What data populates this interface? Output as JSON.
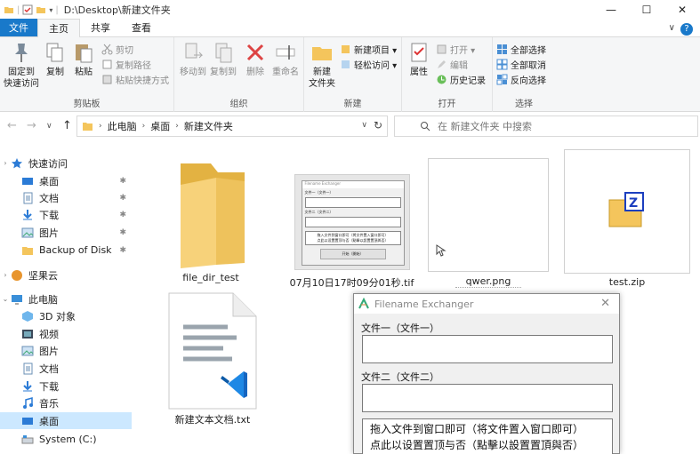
{
  "window": {
    "path": "D:\\Desktop\\新建文件夹",
    "min_glyph": "—",
    "max_glyph": "☐",
    "close_glyph": "✕"
  },
  "menu": {
    "file": "文件",
    "tabs": [
      "主页",
      "共享",
      "查看"
    ],
    "expand_glyph": "∨",
    "help_glyph": "?"
  },
  "ribbon": {
    "clipboard": {
      "label": "剪贴板",
      "pin": [
        "固定到",
        "快速访问"
      ],
      "copy": "复制",
      "paste": "粘贴",
      "cut": "剪切",
      "copy_path": "复制路径",
      "paste_shortcut": "粘贴快捷方式"
    },
    "organize": {
      "label": "组织",
      "move_to": "移动到",
      "copy_to": "复制到",
      "delete": "删除",
      "rename": "重命名"
    },
    "new": {
      "label": "新建",
      "new_folder": [
        "新建",
        "文件夹"
      ],
      "new_item": "新建项目 ▾",
      "easy_access": "轻松访问 ▾"
    },
    "open": {
      "label": "打开",
      "properties": "属性",
      "open": "打开 ▾",
      "edit": "编辑",
      "history": "历史记录"
    },
    "select": {
      "label": "选择",
      "select_all": "全部选择",
      "select_none": "全部取消",
      "invert": "反向选择"
    }
  },
  "address": {
    "back": "←",
    "forward": "→",
    "recent": "∨",
    "up": "↑",
    "crumbs": [
      "此电脑",
      "桌面",
      "新建文件夹"
    ],
    "crumb_sep": "›",
    "dropdown": "∨",
    "refresh": "↻",
    "search_placeholder": "在 新建文件夹 中搜索"
  },
  "sidebar": {
    "quick_access": "快速访问",
    "quick_items": [
      "桌面",
      "文档",
      "下载",
      "图片",
      "Backup of Disk"
    ],
    "pin_glyph": "📌",
    "jianguo": "坚果云",
    "this_pc": "此电脑",
    "pc_items": [
      "3D 对象",
      "视频",
      "图片",
      "文档",
      "下载",
      "音乐",
      "桌面",
      "System (C:)"
    ]
  },
  "files": [
    {
      "name": "file_dir_test"
    },
    {
      "name": "07月10日17时09分01秒.tif"
    },
    {
      "name": "qwer.png"
    },
    {
      "name": "test.zip"
    },
    {
      "name": "新建文本文档.txt"
    }
  ],
  "thumb_dialog": {
    "title": "Filename Exchanger",
    "label1": "文件一（文件一）",
    "label2": "文件二（文件二）",
    "drop": "拖入文件到窗口即可（将文件置入窗口即可）",
    "toggle": "点此以设置置顶与否（點擊以設置置頂與否）",
    "start": "开始（開始）"
  },
  "dialog": {
    "title": "Filename Exchanger",
    "close": "✕",
    "label1": "文件一（文件一）",
    "label2": "文件二（文件二）",
    "drop_line1": "拖入文件到窗口即可（将文件置入窗口即可）",
    "drop_line2": "点此以设置置顶与否（點擊以設置置頂與否）"
  },
  "colors": {
    "accent": "#1979ca",
    "folder": "#f4c55c",
    "selection": "#cce8ff"
  }
}
